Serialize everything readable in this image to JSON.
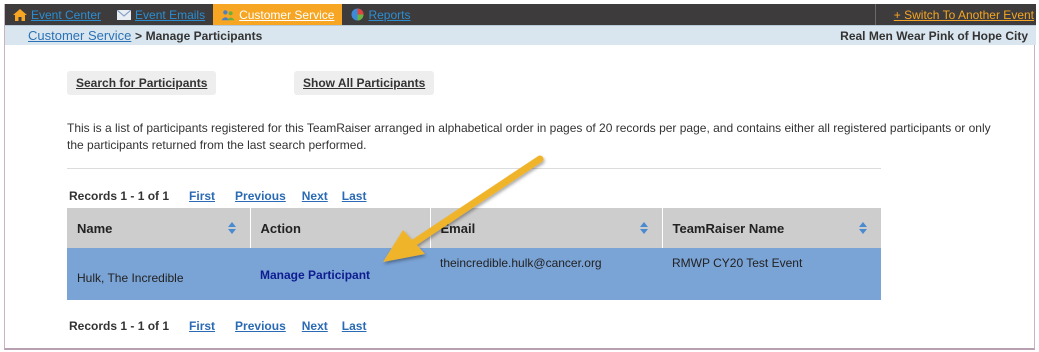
{
  "nav": {
    "items": [
      {
        "label": "Event Center",
        "icon": "home-icon"
      },
      {
        "label": "Event Emails",
        "icon": "envelope-icon"
      },
      {
        "label": "Customer Service",
        "icon": "people-icon"
      },
      {
        "label": "Reports",
        "icon": "pie-chart-icon"
      }
    ],
    "switch_label": "+ Switch To Another Event",
    "colors": {
      "bar": "#3d3b3c",
      "active": "#f6a623",
      "link": "#2b8fd4"
    }
  },
  "breadcrumb": {
    "link": "Customer Service",
    "separator": ">",
    "current": "Manage Participants",
    "event_name": "Real Men Wear Pink of Hope City"
  },
  "actions": {
    "search_label": "Search for Participants",
    "show_all_label": "Show All Participants"
  },
  "description": "This is a list of participants registered for this TeamRaiser arranged in alphabetical order in pages of 20 records per page, and contains either all registered participants or only the participants returned from the last search performed.",
  "pager": {
    "records": "Records 1 - 1 of 1",
    "first": "First",
    "previous": "Previous",
    "next": "Next",
    "last": "Last"
  },
  "table": {
    "headers": [
      "Name",
      "Action",
      "Email",
      "TeamRaiser Name"
    ],
    "rows": [
      {
        "name": "Hulk, The Incredible",
        "action": "Manage Participant",
        "email": "theincredible.hulk@cancer.org",
        "teamraiser": "RMWP CY20 Test Event"
      }
    ],
    "colors": {
      "header": "#cdcdcd",
      "row": "#7aa3d6"
    }
  },
  "annotation": {
    "type": "arrow",
    "color": "#f0b429"
  }
}
